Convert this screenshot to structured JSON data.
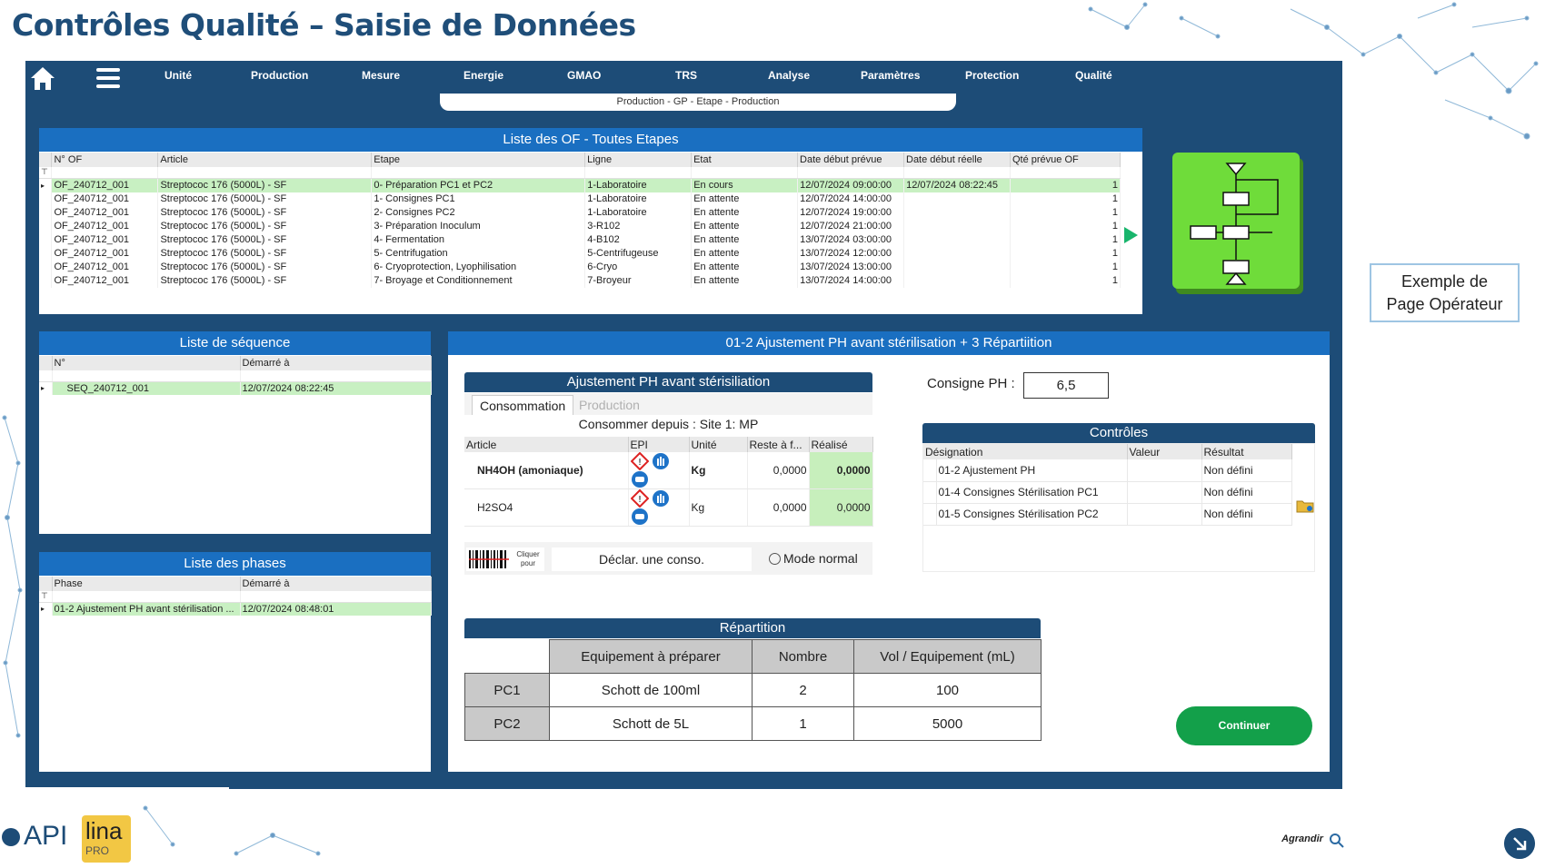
{
  "page": {
    "title": "Contrôles Qualité – Saisie de Données"
  },
  "nav": {
    "items": [
      "Unité",
      "Production",
      "Mesure",
      "Energie",
      "GMAO",
      "TRS",
      "Analyse",
      "Paramètres",
      "Protection",
      "Qualité"
    ],
    "breadcrumb": "Production - GP - Etape - Production"
  },
  "of_list": {
    "title": "Liste des OF - Toutes Etapes",
    "columns": [
      "N° OF",
      "Article",
      "Etape",
      "Ligne",
      "Etat",
      "Date début prévue",
      "Date début réelle",
      "Qté prévue OF"
    ],
    "rows": [
      [
        "OF_240712_001",
        "Streptococ 176 (5000L) - SF",
        "0- Préparation PC1 et PC2",
        "1-Laboratoire",
        "En cours",
        "12/07/2024 09:00:00",
        "12/07/2024 08:22:45",
        "1"
      ],
      [
        "OF_240712_001",
        "Streptococ 176 (5000L) - SF",
        "1- Consignes PC1",
        "1-Laboratoire",
        "En attente",
        "12/07/2024 14:00:00",
        "",
        "1"
      ],
      [
        "OF_240712_001",
        "Streptococ 176 (5000L) - SF",
        "2- Consignes PC2",
        "1-Laboratoire",
        "En attente",
        "12/07/2024 19:00:00",
        "",
        "1"
      ],
      [
        "OF_240712_001",
        "Streptococ 176 (5000L) - SF",
        "3- Préparation Inoculum",
        "3-R102",
        "En attente",
        "12/07/2024 21:00:00",
        "",
        "1"
      ],
      [
        "OF_240712_001",
        "Streptococ 176 (5000L) - SF",
        "4- Fermentation",
        "4-B102",
        "En attente",
        "13/07/2024 03:00:00",
        "",
        "1"
      ],
      [
        "OF_240712_001",
        "Streptococ 176 (5000L) - SF",
        "5- Centrifugation",
        "5-Centrifugeuse",
        "En attente",
        "13/07/2024 12:00:00",
        "",
        "1"
      ],
      [
        "OF_240712_001",
        "Streptococ 176 (5000L) - SF",
        "6- Cryoprotection, Lyophilisation",
        "6-Cryo",
        "En attente",
        "13/07/2024 13:00:00",
        "",
        "1"
      ],
      [
        "OF_240712_001",
        "Streptococ 176 (5000L) - SF",
        "7- Broyage et Conditionnement",
        "7-Broyeur",
        "En attente",
        "13/07/2024 14:00:00",
        "",
        "1"
      ]
    ]
  },
  "operator_note": {
    "line1": "Exemple de",
    "line2": "Page Opérateur"
  },
  "sequence": {
    "title": "Liste de séquence",
    "columns": [
      "N°",
      "Démarré à"
    ],
    "rows": [
      [
        "SEQ_240712_001",
        "12/07/2024 08:22:45"
      ]
    ]
  },
  "phases": {
    "title": "Liste des phases",
    "columns": [
      "Phase",
      "Démarré à"
    ],
    "rows": [
      [
        "01-2 Ajustement PH avant stérilisation ...",
        "12/07/2024 08:48:01"
      ]
    ]
  },
  "main": {
    "title": "01-2 Ajustement PH avant stérilisation + 3 Répartiition",
    "ajustement": {
      "title": "Ajustement PH avant stérisiliation",
      "tabs": [
        "Consommation",
        "Production"
      ],
      "source": "Consommer depuis : Site 1: MP",
      "columns": [
        "Article",
        "EPI",
        "Unité",
        "Reste à f...",
        "Réalisé"
      ],
      "rows": [
        {
          "article": "NH4OH (amoniaque)",
          "unit": "Kg",
          "reste": "0,0000",
          "realise": "0,0000"
        },
        {
          "article": "H2SO4",
          "unit": "Kg",
          "reste": "0,0000",
          "realise": "0,0000"
        }
      ],
      "barcode_label": "Cliquer pour",
      "declar_label": "Déclar. une conso.",
      "mode_label": "Mode normal"
    },
    "consigne": {
      "label": "Consigne PH :",
      "value": "6,5"
    },
    "controles": {
      "title": "Contrôles",
      "columns": [
        "Désignation",
        "Valeur",
        "Résultat"
      ],
      "rows": [
        [
          "01-2 Ajustement PH",
          "",
          "Non défini"
        ],
        [
          "01-4 Consignes Stérilisation PC1",
          "",
          "Non défini"
        ],
        [
          "01-5 Consignes Stérilisation PC2",
          "",
          "Non défini"
        ]
      ]
    },
    "repartition": {
      "title": "Répartition",
      "columns": [
        "Equipement à préparer",
        "Nombre",
        "Vol / Equipement (mL)"
      ],
      "rows": [
        [
          "PC1",
          "Schott de 100ml",
          "2",
          "100"
        ],
        [
          "PC2",
          "Schott de 5L",
          "1",
          "5000"
        ]
      ]
    },
    "continue_label": "Continuer"
  },
  "agrandir_label": "Agrandir",
  "logos": {
    "api": "API",
    "lina": "lina",
    "pro": "PRO"
  },
  "colors": {
    "frame": "#1d4c77",
    "header": "#1a6fc1",
    "selected": "#c8f0c2",
    "continue": "#13a04a",
    "flow": "#6fdc3a"
  },
  "icons": [
    "home-icon",
    "menu-icon",
    "play-arrow-icon",
    "flowchart-icon",
    "danger-icon",
    "glove-icon",
    "mask-icon",
    "barcode-icon",
    "folder-icon",
    "search-icon"
  ]
}
